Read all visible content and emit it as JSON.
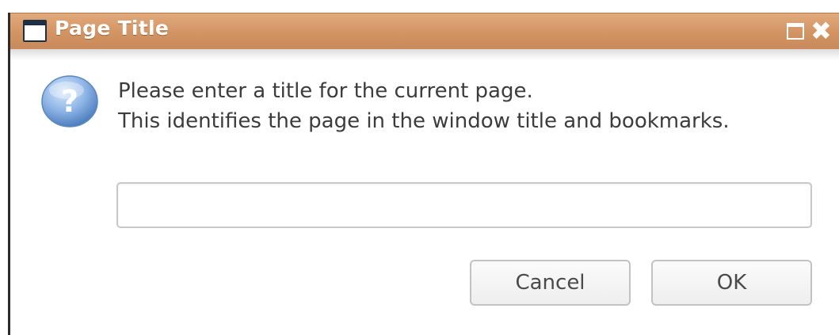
{
  "window": {
    "title": "Page Title",
    "icon": "window-icon",
    "controls": {
      "maximize_icon": "maximize-icon",
      "close_glyph": "✖"
    },
    "accent_color": "#d39463"
  },
  "dialog": {
    "icon": "question-icon",
    "message_line1": "Please enter a title for the current page.",
    "message_line2": "This identifies the page in the window title and bookmarks.",
    "input": {
      "value": "",
      "placeholder": ""
    },
    "buttons": {
      "cancel_label": "Cancel",
      "ok_label": "OK"
    }
  }
}
